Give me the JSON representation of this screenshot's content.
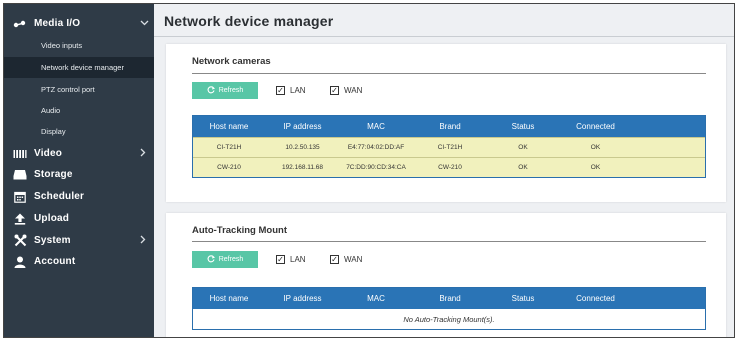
{
  "sidebar": {
    "media_io": {
      "label": "Media I/O",
      "icon": "media-io-icon"
    },
    "media_sub": [
      "Video inputs",
      "Network device manager",
      "PTZ control port",
      "Audio",
      "Display"
    ],
    "active_sub": "Network device manager",
    "items": [
      {
        "label": "Video",
        "icon": "video-icon",
        "has_arrow": true
      },
      {
        "label": "Storage",
        "icon": "storage-icon",
        "has_arrow": false
      },
      {
        "label": "Scheduler",
        "icon": "calendar-icon",
        "has_arrow": false
      },
      {
        "label": "Upload",
        "icon": "upload-icon",
        "has_arrow": false
      },
      {
        "label": "System",
        "icon": "tools-icon",
        "has_arrow": true
      },
      {
        "label": "Account",
        "icon": "user-icon",
        "has_arrow": false
      }
    ]
  },
  "page": {
    "title": "Network device manager"
  },
  "network_cameras": {
    "title": "Network cameras",
    "refresh_label": "Refresh",
    "lan_label": "LAN",
    "wan_label": "WAN",
    "lan_checked": true,
    "wan_checked": true,
    "columns": [
      "Host name",
      "IP address",
      "MAC",
      "Brand",
      "Status",
      "Connected"
    ],
    "rows": [
      [
        "CI-T21H",
        "10.2.50.135",
        "E4:77:04:02:DD:AF",
        "CI-T21H",
        "OK",
        "OK"
      ],
      [
        "CW-210",
        "192.168.11.68",
        "7C:DD:90:CD:34:CA",
        "CW-210",
        "OK",
        "OK"
      ]
    ]
  },
  "auto_tracking": {
    "title": "Auto-Tracking Mount",
    "refresh_label": "Refresh",
    "lan_label": "LAN",
    "wan_label": "WAN",
    "lan_checked": true,
    "wan_checked": true,
    "columns": [
      "Host name",
      "IP address",
      "MAC",
      "Brand",
      "Status",
      "Connected"
    ],
    "empty_text": "No Auto-Tracking Mount(s)."
  },
  "colors": {
    "sidebar_bg": "#2f3b47",
    "table_header": "#2a74b6",
    "row_highlight": "#f1f1bd",
    "refresh_button": "#58c6a6"
  }
}
